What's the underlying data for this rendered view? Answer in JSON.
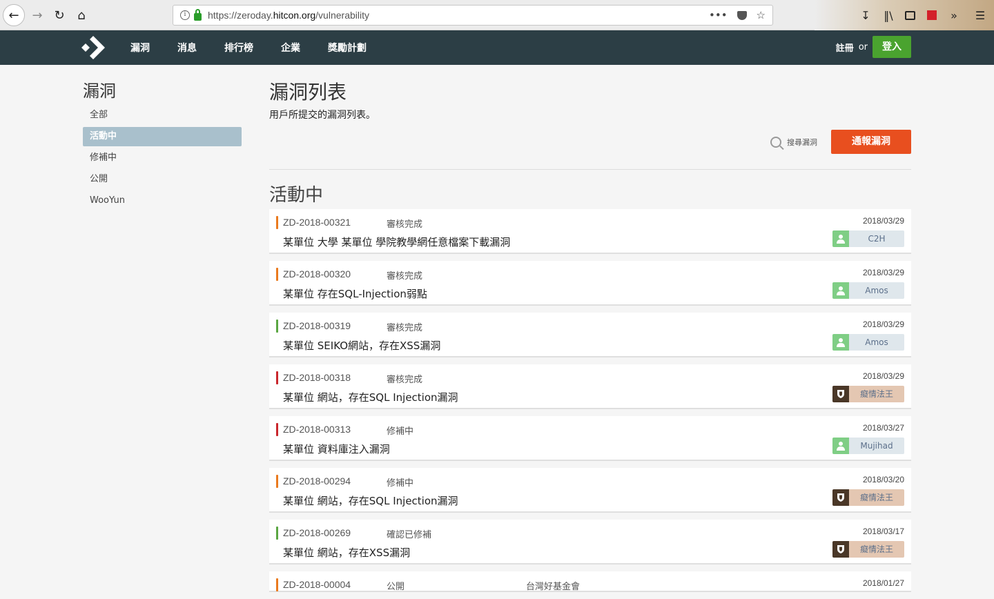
{
  "browser": {
    "url_prefix": "https://zeroday.",
    "url_domain": "hitcon.org",
    "url_path": "/vulnerability",
    "menu_dots": "•••"
  },
  "header": {
    "nav": [
      "漏洞",
      "消息",
      "排行榜",
      "企業",
      "獎勵計劃"
    ],
    "register": "註冊",
    "or": "or",
    "login": "登入"
  },
  "sidebar": {
    "title": "漏洞",
    "items": [
      {
        "label": "全部",
        "active": false
      },
      {
        "label": "活動中",
        "active": true
      },
      {
        "label": "修補中",
        "active": false
      },
      {
        "label": "公開",
        "active": false
      },
      {
        "label": "WooYun",
        "active": false
      }
    ]
  },
  "main": {
    "title": "漏洞列表",
    "subtitle": "用戶所提交的漏洞列表。",
    "search_label": "搜尋漏洞",
    "report_label": "通報漏洞",
    "section_title": "活動中"
  },
  "colors": {
    "orange": "#ea7a1e",
    "green": "#5aa642",
    "red": "#c9262c"
  },
  "rows": [
    {
      "id": "ZD-2018-00321",
      "status": "審核完成",
      "title": "某單位 大學 某單位 學院教學網任意檔案下載漏洞",
      "date": "2018/03/29",
      "user": "C2H",
      "user_type": "green",
      "severity": "orange"
    },
    {
      "id": "ZD-2018-00320",
      "status": "審核完成",
      "title": "某單位 存在SQL-Injection弱點",
      "date": "2018/03/29",
      "user": "Amos",
      "user_type": "green",
      "severity": "orange"
    },
    {
      "id": "ZD-2018-00319",
      "status": "審核完成",
      "title": "某單位 SEIKO網站，存在XSS漏洞",
      "date": "2018/03/29",
      "user": "Amos",
      "user_type": "green",
      "severity": "green"
    },
    {
      "id": "ZD-2018-00318",
      "status": "審核完成",
      "title": "某單位 網站，存在SQL Injection漏洞",
      "date": "2018/03/29",
      "user": "癡情法王",
      "user_type": "brown",
      "severity": "red"
    },
    {
      "id": "ZD-2018-00313",
      "status": "修補中",
      "title": "某單位 資料庫注入漏洞",
      "date": "2018/03/27",
      "user": "Mujihad",
      "user_type": "green",
      "severity": "red"
    },
    {
      "id": "ZD-2018-00294",
      "status": "修補中",
      "title": "某單位 網站，存在SQL Injection漏洞",
      "date": "2018/03/20",
      "user": "癡情法王",
      "user_type": "brown",
      "severity": "orange"
    },
    {
      "id": "ZD-2018-00269",
      "status": "確認已修補",
      "title": "某單位 網站，存在XSS漏洞",
      "date": "2018/03/17",
      "user": "癡情法王",
      "user_type": "brown",
      "severity": "green"
    }
  ],
  "partial_row": {
    "id": "ZD-2018-00004",
    "status": "公開",
    "title": "台灣好基金會",
    "date": "2018/01/27"
  }
}
